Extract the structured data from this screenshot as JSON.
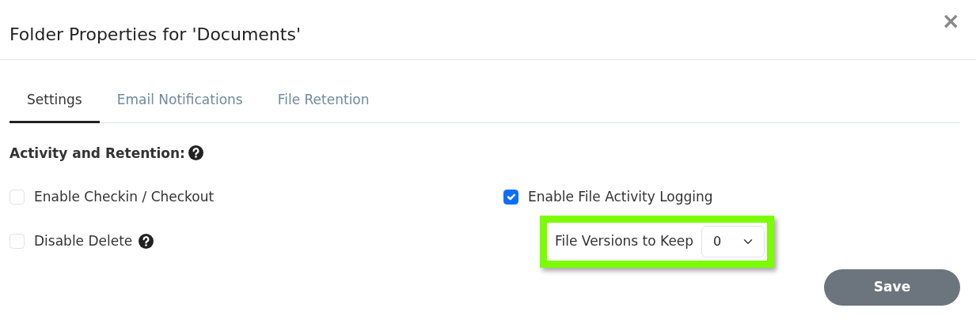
{
  "window": {
    "title": "Folder Properties for 'Documents'",
    "close": "×"
  },
  "tabs": [
    {
      "label": "Settings",
      "selected": true
    },
    {
      "label": "Email Notifications",
      "selected": false
    },
    {
      "label": "File Retention",
      "selected": false
    }
  ],
  "section": {
    "heading": "Activity and Retention:",
    "help": true
  },
  "options_left": [
    {
      "label": "Enable Checkin / Checkout",
      "checked": false,
      "help": false
    },
    {
      "label": "Disable Delete",
      "checked": false,
      "help": true
    }
  ],
  "options_right": [
    {
      "label": "Enable File Activity Logging",
      "checked": true,
      "help": false
    }
  ],
  "versions": {
    "label": "File Versions to Keep",
    "value": "0",
    "highlighted": true
  },
  "buttons": [
    {
      "label": "Save"
    }
  ]
}
